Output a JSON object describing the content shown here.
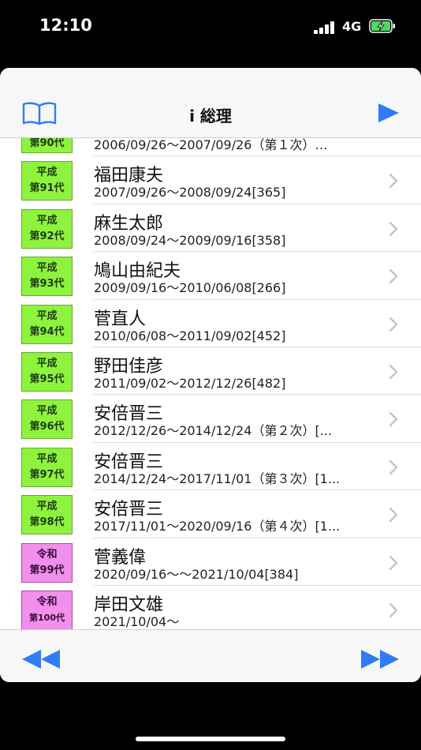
{
  "status": {
    "time": "12:10",
    "network": "4G",
    "battery_color": "#4cd964"
  },
  "navbar": {
    "title": "i 総理",
    "book_icon": "book-icon",
    "play_icon": "play-icon",
    "accent": "#2f7cf6"
  },
  "list": {
    "partial_row": {
      "period": "2006/09/26～2007/09/26（第１次）…"
    },
    "rows": [
      {
        "era": "平成",
        "generation": "第91代",
        "name": "福田康夫",
        "period": "2007/09/26～2008/09/24[365]",
        "type": "heisei"
      },
      {
        "era": "平成",
        "generation": "第92代",
        "name": "麻生太郎",
        "period": "2008/09/24～2009/09/16[358]",
        "type": "heisei"
      },
      {
        "era": "平成",
        "generation": "第93代",
        "name": "鳩山由紀夫",
        "period": "2009/09/16～2010/06/08[266]",
        "type": "heisei"
      },
      {
        "era": "平成",
        "generation": "第94代",
        "name": "菅直人",
        "period": "2010/06/08～2011/09/02[452]",
        "type": "heisei"
      },
      {
        "era": "平成",
        "generation": "第95代",
        "name": "野田佳彦",
        "period": "2011/09/02～2012/12/26[482]",
        "type": "heisei"
      },
      {
        "era": "平成",
        "generation": "第96代",
        "name": "安倍晋三",
        "period": "2012/12/26～2014/12/24（第２次）[...",
        "type": "heisei"
      },
      {
        "era": "平成",
        "generation": "第97代",
        "name": "安倍晋三",
        "period": "2014/12/24～2017/11/01（第３次）[1...",
        "type": "heisei"
      },
      {
        "era": "平成",
        "generation": "第98代",
        "name": "安倍晋三",
        "period": "2017/11/01～2020/09/16（第４次）[1...",
        "type": "heisei"
      },
      {
        "era": "令和",
        "generation": "第99代",
        "name": "菅義偉",
        "period": "2020/09/16～～2021/10/04[384]",
        "type": "reiwa"
      },
      {
        "era": "令和",
        "generation": "第100代",
        "name": "岸田文雄",
        "period": "2021/10/04～",
        "type": "reiwa"
      }
    ]
  },
  "bottom": {
    "rewind_icon": "rewind-icon",
    "fast_forward_icon": "fast-forward-icon"
  }
}
